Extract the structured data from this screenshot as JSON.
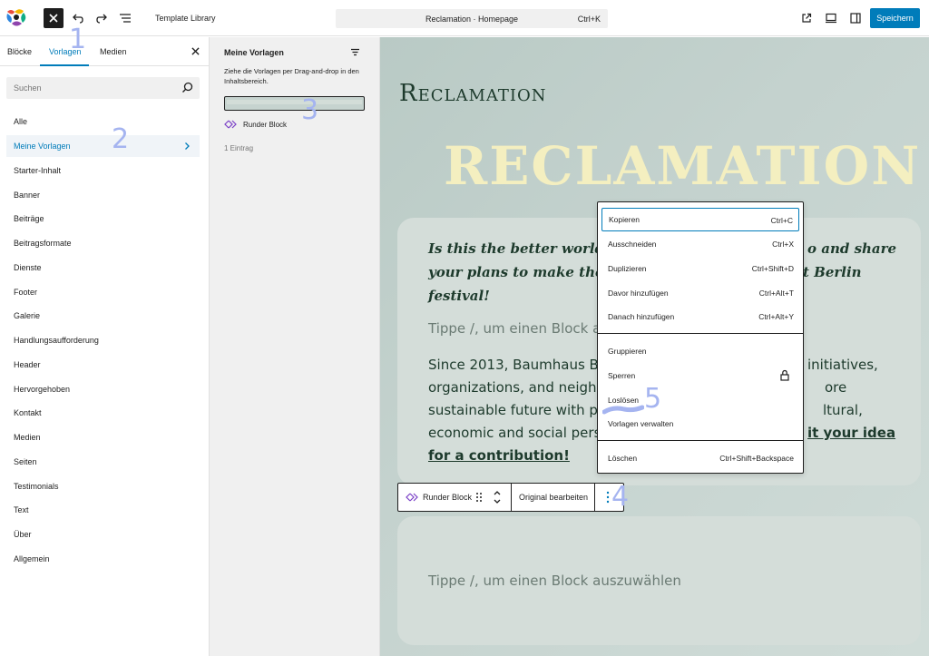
{
  "topbar": {
    "title": "Template Library",
    "command_title": "Reclamation · Homepage",
    "command_shortcut": "Ctrl+K",
    "save_label": "Speichern"
  },
  "sidebar": {
    "tabs": [
      "Blöcke",
      "Vorlagen",
      "Medien"
    ],
    "search_placeholder": "Suchen",
    "categories": [
      "Alle",
      "Meine Vorlagen",
      "Starter-Inhalt",
      "Banner",
      "Beiträge",
      "Beitragsformate",
      "Dienste",
      "Footer",
      "Galerie",
      "Handlungsaufforderung",
      "Header",
      "Hervorgehoben",
      "Kontakt",
      "Medien",
      "Seiten",
      "Testimonials",
      "Text",
      "Über",
      "Allgemein"
    ]
  },
  "patterns_panel": {
    "title": "Meine Vorlagen",
    "description": "Ziehe die Vorlagen per Drag-and-drop in den Inhaltsbereich.",
    "item_label": "Runder Block",
    "count": "1 Eintrag"
  },
  "canvas": {
    "site_title": "Reclamation",
    "big_title": "RECLAMATION",
    "headline_line1": "Is this the better world w",
    "headline_line2": "your plans to make the wo",
    "headline_line3": "festival!",
    "headline_right1": "o and share",
    "headline_right2": "t Berlin",
    "placeholder1": "Tippe /, um einen Block au",
    "body_line1": "Since 2013, Baumhaus Be",
    "body_line2": "organizations, and neighb",
    "body_line3": "sustainable future with pe",
    "body_line4": "economic and social persp",
    "body_right1": "initiatives,",
    "body_right2": "ore",
    "body_right3": "ltural,",
    "body_right4": "it your idea",
    "body_link": "for a contribution!",
    "placeholder2": "Tippe /, um einen Block auszuwählen"
  },
  "block_toolbar": {
    "label": "Runder Block",
    "edit_original": "Original bearbeiten"
  },
  "menu": {
    "group1": [
      {
        "label": "Kopieren",
        "shortcut": "Ctrl+C"
      },
      {
        "label": "Ausschneiden",
        "shortcut": "Ctrl+X"
      },
      {
        "label": "Duplizieren",
        "shortcut": "Ctrl+Shift+D"
      },
      {
        "label": "Davor hinzufügen",
        "shortcut": "Ctrl+Alt+T"
      },
      {
        "label": "Danach hinzufügen",
        "shortcut": "Ctrl+Alt+Y"
      }
    ],
    "group2": [
      {
        "label": "Gruppieren"
      },
      {
        "label": "Sperren"
      },
      {
        "label": "Loslösen"
      },
      {
        "label": "Vorlagen verwalten"
      }
    ],
    "group3": [
      {
        "label": "Löschen",
        "shortcut": "Ctrl+Shift+Backspace"
      }
    ]
  },
  "annotations": [
    "1",
    "2",
    "3",
    "4",
    "5"
  ],
  "colors": {
    "accent": "#007cba",
    "canvas_bg": "#c4d2ce",
    "title_green": "#1d3a2c",
    "big_title_cream": "#f4efc0",
    "annotation": "#a5b4f0"
  }
}
